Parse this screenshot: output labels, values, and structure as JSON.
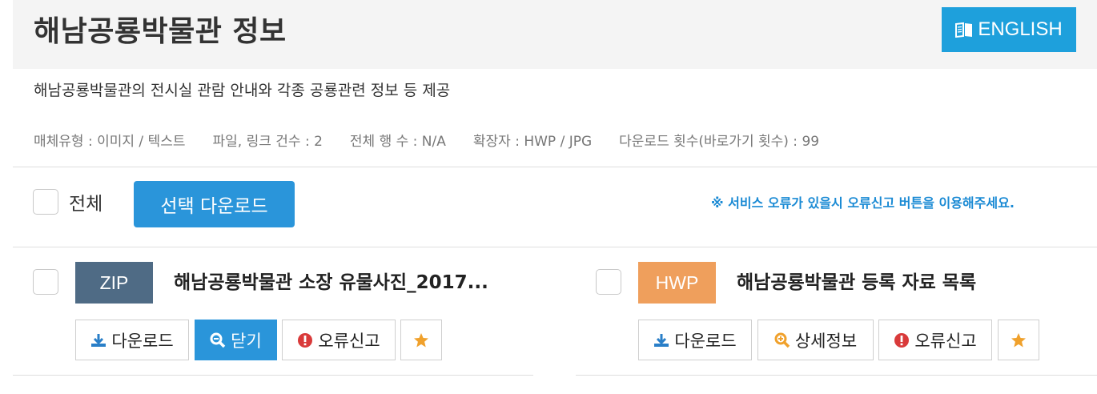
{
  "header": {
    "title": "해남공룡박물관 정보",
    "english_button": "ENGLISH"
  },
  "description": "해남공룡박물관의 전시실 관람 안내와 각종 공룡관련 정보 등 제공",
  "meta": {
    "media_type": "매체유형 : 이미지 / 텍스트",
    "file_count": "파일, 링크 건수 : 2",
    "row_count": "전체 행 수 : N/A",
    "extensions": "확장자 : HWP / JPG",
    "download_count": "다운로드 횟수(바로가기 횟수) : 99"
  },
  "toolbar": {
    "select_all_label": "전체",
    "select_download_label": "선택 다운로드",
    "notice": "※ 서비스 오류가 있을시 오류신고 버튼을 이용해주세요."
  },
  "files": [
    {
      "type": "ZIP",
      "type_color": "#4f6b85",
      "title": "해남공룡박물관 소장 유물사진_2017...",
      "buttons": {
        "download": "다운로드",
        "second": "닫기",
        "report": "오류신고"
      }
    },
    {
      "type": "HWP",
      "type_color": "#ef9f5c",
      "title": "해남공룡박물관 등록 자료 목록",
      "buttons": {
        "download": "다운로드",
        "second": "상세정보",
        "report": "오류신고"
      }
    }
  ],
  "colors": {
    "accent_blue": "#2a95da",
    "english_button": "#1ea0dc",
    "error_red": "#d93a3a",
    "star_orange": "#f0a12c"
  },
  "icons": {
    "english": "book-icon",
    "download": "download-icon",
    "close": "zoom-icon",
    "detail": "zoom-icon",
    "report": "exclamation-circle-icon",
    "favorite": "star-icon"
  }
}
